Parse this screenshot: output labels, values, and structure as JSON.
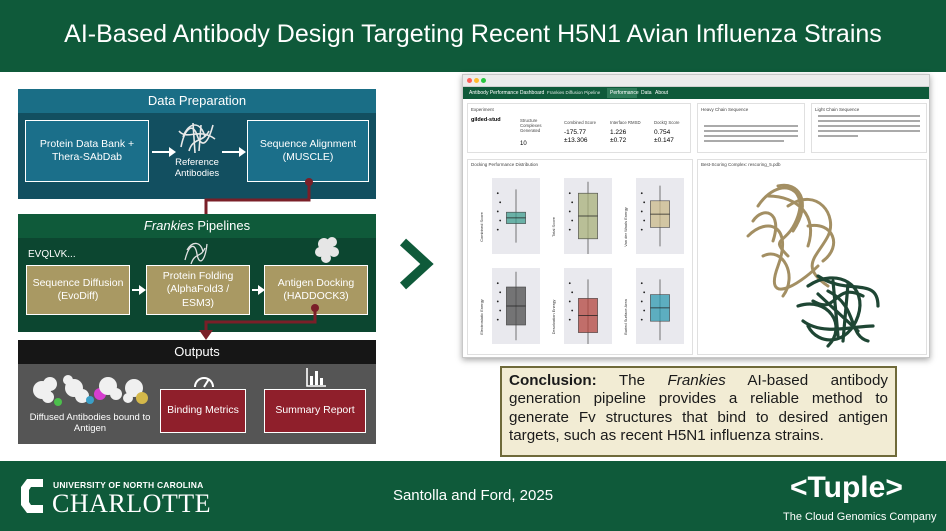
{
  "title": "AI-Based Antibody Design Targeting Recent H5N1 Avian Influenza Strains",
  "flow": {
    "data_prep": {
      "heading": "Data Preparation",
      "source_box": "Protein Data Bank + Thera-SAbDab",
      "reference_label": "Reference Antibodies",
      "alignment_box": "Sequence Alignment (MUSCLE)"
    },
    "pipelines": {
      "heading_italic": "Frankies",
      "heading_rest": " Pipelines",
      "seq_text": "EVQLVK...",
      "diffusion_box": "Sequence Diffusion (EvoDiff)",
      "folding_box": "Protein Folding (AlphaFold3 / ESM3)",
      "docking_box": "Antigen Docking (HADDOCK3)"
    },
    "outputs": {
      "heading": "Outputs",
      "antibodies_label": "Diffused Antibodies bound to Antigen",
      "binding_box": "Binding Metrics",
      "summary_box": "Summary Report"
    }
  },
  "dashboard": {
    "app_title": "Antibody Performance Dashboard",
    "app_subtitle": "Frankies Diffusion Pipeline",
    "tabs": [
      "Performance",
      "Data",
      "About"
    ],
    "experiment_label": "Experiment",
    "experiment_value": "gilded-stud",
    "metrics": [
      {
        "label": "Structure Complexes Generated",
        "value": "10",
        "sub": ""
      },
      {
        "label": "Combined Score",
        "value": "-175.77",
        "sub": "±13.306"
      },
      {
        "label": "Interface RMSD",
        "value": "1.226",
        "sub": "±0.72"
      },
      {
        "label": "DockQ Score",
        "value": "0.754",
        "sub": "±0.147"
      }
    ],
    "heavy_chain_label": "Heavy Chain Sequence",
    "light_chain_label": "Light Chain Sequence",
    "dist_label": "Docking Performance Distribution",
    "best_label": "Best-Scoring Complex: rescoring_5.pdb",
    "boxplots": [
      {
        "ylabel": "Combined Score",
        "color": "#3f9e8f"
      },
      {
        "ylabel": "Total Score",
        "color": "#a8b07a"
      },
      {
        "ylabel": "Van der Waals Energy",
        "color": "#c9b98a"
      },
      {
        "ylabel": "Electrostatic Energy",
        "color": "#4c4c4c"
      },
      {
        "ylabel": "Desolvation Energy",
        "color": "#b3443e"
      },
      {
        "ylabel": "Buried Surface Area",
        "color": "#2e9ab0"
      }
    ]
  },
  "conclusion": {
    "lead": "Conclusion:",
    "part1": " The ",
    "italic": "Frankies",
    "part2": " AI-based antibody generation pipeline provides a reliable method to generate Fv structures that bind to desired antigen targets, such as recent H5N1 influenza strains."
  },
  "footer": {
    "uni_line": "UNIVERSITY OF NORTH CAROLINA",
    "uni_name": "CHARLOTTE",
    "citation": "Santolla and Ford, 2025",
    "company": "Tuple",
    "company_tagline": "The Cloud Genomics Company"
  },
  "colors": {
    "green": "#0f5a3a",
    "teal": "#1b6f8a",
    "tan": "#a99963",
    "maroon": "#8f1f2b"
  }
}
